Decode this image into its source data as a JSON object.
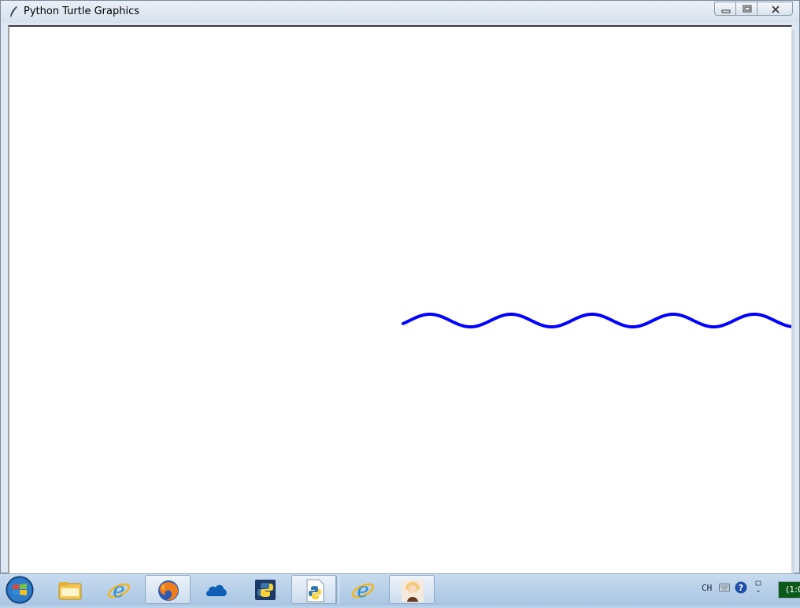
{
  "window": {
    "title": "Python Turtle Graphics"
  },
  "canvas": {
    "pen_color": "#0000ff",
    "background": "#ffffff",
    "drawing": "sine-wave"
  },
  "taskbar": {
    "items": [
      {
        "name": "start-button",
        "icon": "windows-orb-icon"
      },
      {
        "name": "file-explorer",
        "icon": "folder-icon"
      },
      {
        "name": "internet-explorer",
        "icon": "ie-icon"
      },
      {
        "name": "firefox",
        "icon": "firefox-icon",
        "active": true
      },
      {
        "name": "onedrive",
        "icon": "cloud-icon"
      },
      {
        "name": "python-idle",
        "icon": "python-icon"
      },
      {
        "name": "python-file",
        "icon": "python-file-icon",
        "active": true
      },
      {
        "name": "internet-explorer-2",
        "icon": "ie-icon"
      },
      {
        "name": "image-app",
        "icon": "picture-icon",
        "active": true
      }
    ],
    "tray": {
      "language": "CH",
      "clock": "(1:0"
    }
  }
}
